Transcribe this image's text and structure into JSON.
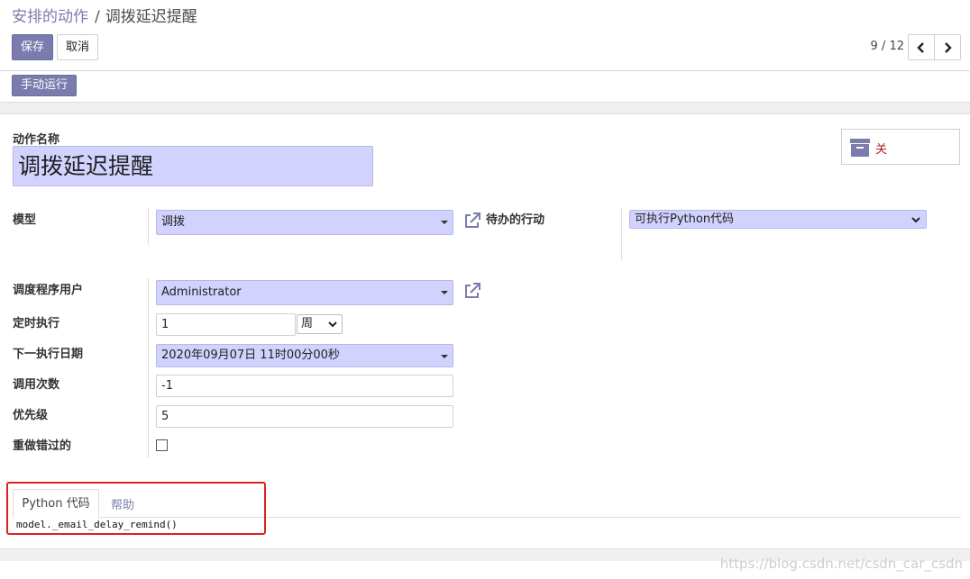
{
  "breadcrumb": {
    "parent": "安排的动作",
    "separator": "/",
    "current": "调拨延迟提醒"
  },
  "toolbar": {
    "save_label": "保存",
    "cancel_label": "取消",
    "pager_value": "9 / 12"
  },
  "statusbar": {
    "run_label": "手动运行"
  },
  "form": {
    "name_label": "动作名称",
    "name_value": "调拨延迟提醒",
    "archive_label": "关",
    "model_label": "模型",
    "model_value": "调拨",
    "action_label": "待办的行动",
    "action_value": "可执行Python代码",
    "user_label": "调度程序用户",
    "user_value": "Administrator",
    "interval_label": "定时执行",
    "interval_number": "1",
    "interval_unit": "周",
    "nextcall_label": "下一执行日期",
    "nextcall_value": "2020年09月07日 11时00分00秒",
    "numbercall_label": "调用次数",
    "numbercall_value": "-1",
    "priority_label": "优先级",
    "priority_value": "5",
    "doall_label": "重做错过的",
    "doall_checked": false
  },
  "tabs": [
    {
      "label": "Python 代码",
      "active": true
    },
    {
      "label": "帮助",
      "active": false
    }
  ],
  "code": "model._email_delay_remind()",
  "watermark": "https://blog.csdn.net/csdn_car_csdn",
  "colors": {
    "accent": "#7c7bad",
    "required_field": "#d2d2ff",
    "highlight_box": "#e02020",
    "archive_text": "#b02020"
  },
  "icons": {
    "pager_prev": "chevron-left-icon",
    "pager_next": "chevron-right-icon",
    "archive": "archive-box-icon",
    "external_link": "external-link-icon"
  }
}
